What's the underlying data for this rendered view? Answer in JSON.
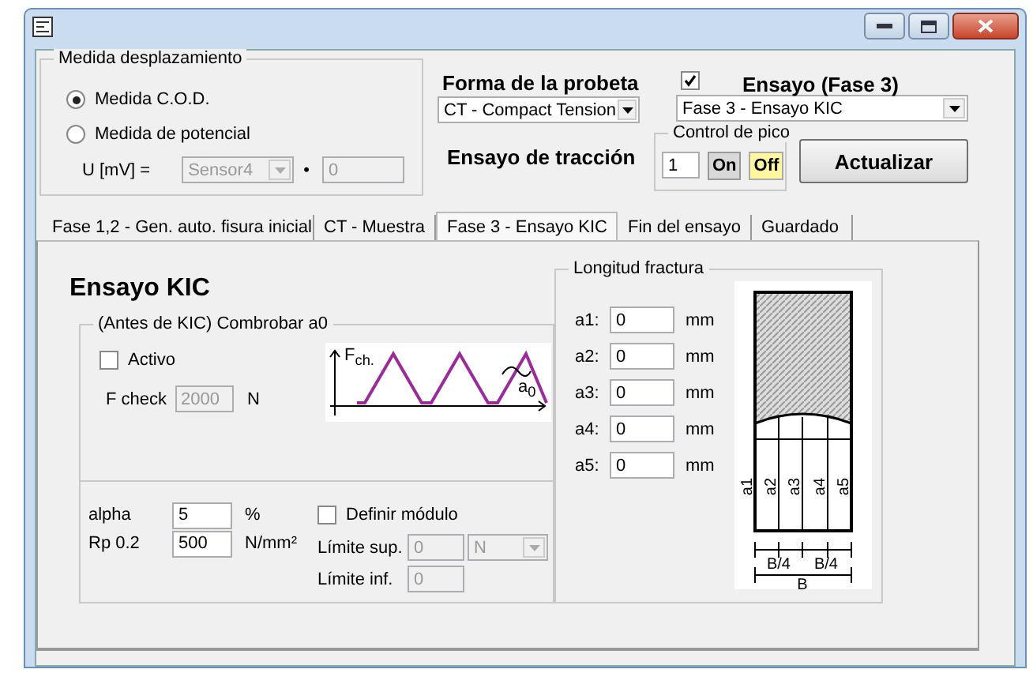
{
  "displacement": {
    "title": "Medida desplazamiento",
    "options": [
      {
        "label": "Medida C.O.D.",
        "selected": true
      },
      {
        "label": "Medida de potencial",
        "selected": false
      }
    ],
    "u_label": "U [mV] =",
    "sensor": {
      "value": "Sensor4",
      "disabled": true
    },
    "separator": "•",
    "factor": {
      "value": "0",
      "disabled": true
    }
  },
  "specimen": {
    "label": "Forma de la probeta",
    "value": "CT - Compact Tension"
  },
  "test": {
    "checked": true,
    "label": "Ensayo (Fase 3)",
    "value": "Fase 3 - Ensayo KIC"
  },
  "tensile_label": "Ensayo de tracción",
  "peak_control": {
    "title": "Control de pico",
    "value": "1",
    "buttons": [
      {
        "label": "On",
        "selected": false
      },
      {
        "label": "Off",
        "selected": true
      }
    ]
  },
  "update_button": "Actualizar",
  "tabs": [
    {
      "label": "Fase 1,2 - Gen. auto. fisura inicial",
      "selected": false
    },
    {
      "label": "CT - Muestra",
      "selected": false
    },
    {
      "label": "Fase 3 - Ensayo KIC",
      "selected": true
    },
    {
      "label": "Fin del ensayo",
      "selected": false
    },
    {
      "label": "Guardado",
      "selected": false
    }
  ],
  "panel": {
    "heading": "Ensayo KIC",
    "check_group": {
      "title": "(Antes de KIC) Combrobar a0",
      "active": {
        "label": "Activo",
        "checked": false
      },
      "f_check": {
        "label": "F check",
        "value": "2000",
        "unit": "N",
        "disabled": true
      },
      "diagram": {
        "force_label": "F$_{ch.}$",
        "crack_label": "a$_{0}$"
      }
    },
    "material": {
      "alpha": {
        "label": "alpha",
        "value": "5",
        "unit": "%"
      },
      "rp": {
        "label": "Rp 0.2",
        "value": "500",
        "unit": "N/mm²"
      },
      "define_modulus": {
        "label": "Definir módulo",
        "checked": false
      },
      "upper": {
        "label": "Límite sup.",
        "value": "0",
        "unit": "N",
        "disabled": true
      },
      "lower": {
        "label": "Límite inf.",
        "value": "0",
        "disabled": true
      }
    },
    "fracture": {
      "title": "Longitud fractura",
      "rows": [
        {
          "label": "a1:",
          "value": "0",
          "unit": "mm"
        },
        {
          "label": "a2:",
          "value": "0",
          "unit": "mm"
        },
        {
          "label": "a3:",
          "value": "0",
          "unit": "mm"
        },
        {
          "label": "a4:",
          "value": "0",
          "unit": "mm"
        },
        {
          "label": "a5:",
          "value": "0",
          "unit": "mm"
        }
      ],
      "diagram": {
        "crack_labels": [
          "a1",
          "a2",
          "a3",
          "a4",
          "a5"
        ],
        "width_labels": [
          "B/4",
          "B/4"
        ],
        "total_label": "B"
      }
    }
  }
}
